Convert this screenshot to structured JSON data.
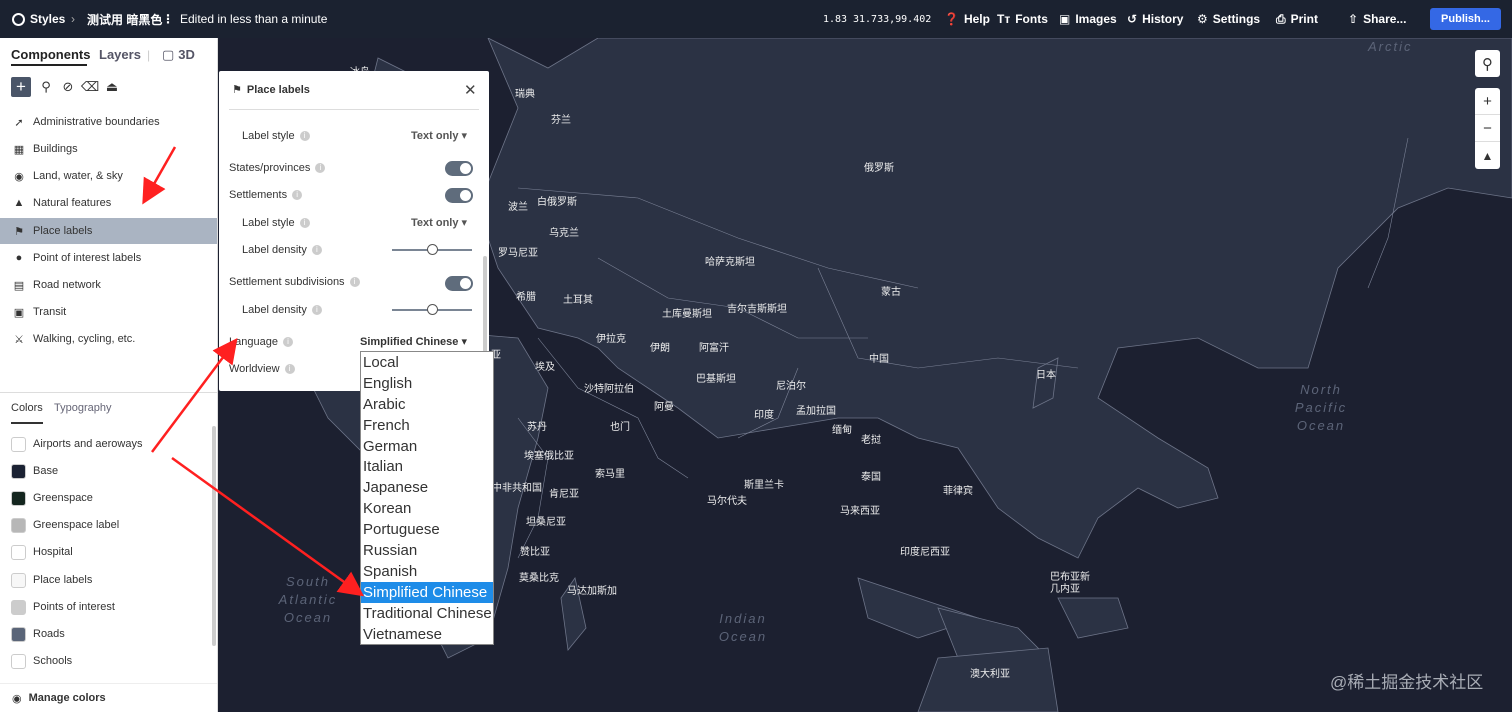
{
  "topbar": {
    "app": "Styles",
    "style_name": "测试用 暗黑色",
    "edited": "Edited in less than a minute",
    "zoom": "1.83",
    "coords": "31.733,99.402",
    "help": "Help",
    "fonts": "Fonts",
    "images": "Images",
    "history": "History",
    "settings": "Settings",
    "print": "Print",
    "share": "Share...",
    "publish": "Publish..."
  },
  "sidebar": {
    "tabs": [
      "Components",
      "Layers",
      "3D"
    ],
    "components": [
      "Administrative boundaries",
      "Buildings",
      "Land, water, & sky",
      "Natural features",
      "Place labels",
      "Point of interest labels",
      "Road network",
      "Transit",
      "Walking, cycling, etc."
    ],
    "color_tabs": [
      "Colors",
      "Typography"
    ],
    "colors": [
      {
        "label": "Airports and aeroways",
        "color": "#ffffff"
      },
      {
        "label": "Base",
        "color": "#1b2233"
      },
      {
        "label": "Greenspace",
        "color": "#14261f"
      },
      {
        "label": "Greenspace label",
        "color": "#b7b7b7"
      },
      {
        "label": "Hospital",
        "color": "#ffffff"
      },
      {
        "label": "Place labels",
        "color": "#f7f7f7"
      },
      {
        "label": "Points of interest",
        "color": "#cccccc"
      },
      {
        "label": "Roads",
        "color": "#5a6578"
      },
      {
        "label": "Schools",
        "color": "#ffffff"
      }
    ],
    "manage": "Manage colors"
  },
  "popover": {
    "title": "Place labels",
    "label_style": "Label style",
    "text_only": "Text only",
    "states": "States/provinces",
    "settlements": "Settlements",
    "label_density": "Label density",
    "subdivisions": "Settlement subdivisions",
    "language": "Language",
    "language_value": "Simplified Chinese",
    "worldview": "Worldview"
  },
  "language_options": [
    "Local",
    "English",
    "Arabic",
    "French",
    "German",
    "Italian",
    "Japanese",
    "Korean",
    "Portuguese",
    "Russian",
    "Spanish",
    "Simplified Chinese",
    "Traditional Chinese",
    "Vietnamese"
  ],
  "language_selected": "Simplified Chinese",
  "map": {
    "labels": [
      "冰岛",
      "瑞典",
      "芬兰",
      "俄罗斯",
      "波兰",
      "白俄罗斯",
      "乌克兰",
      "罗马尼亚",
      "哈萨克斯坦",
      "蒙古",
      "希腊",
      "土耳其",
      "土库曼斯坦",
      "吉尔吉斯斯坦",
      "伊拉克",
      "伊朗",
      "阿富汗",
      "中国",
      "日本",
      "巴基斯坦",
      "尼泊尔",
      "沙特阿拉伯",
      "阿曼",
      "印度",
      "孟加拉国",
      "缅甸",
      "老挝",
      "苏丹",
      "也门",
      "埃及",
      "埃塞俄比亚",
      "索马里",
      "斯里兰卡",
      "马尔代夫",
      "泰国",
      "菲律宾",
      "马来西亚",
      "印度尼西亚",
      "坦桑尼亚",
      "肯尼亚",
      "中非共和国",
      "赞比亚",
      "莫桑比克",
      "马达加斯加",
      "巴布亚新几内亚",
      "澳大利亚",
      "亚"
    ],
    "oceans": [
      "Arctic",
      "North Pacific Ocean",
      "South Atlantic Ocean",
      "Indian Ocean"
    ],
    "watermark": "@稀土掘金技术社区"
  }
}
